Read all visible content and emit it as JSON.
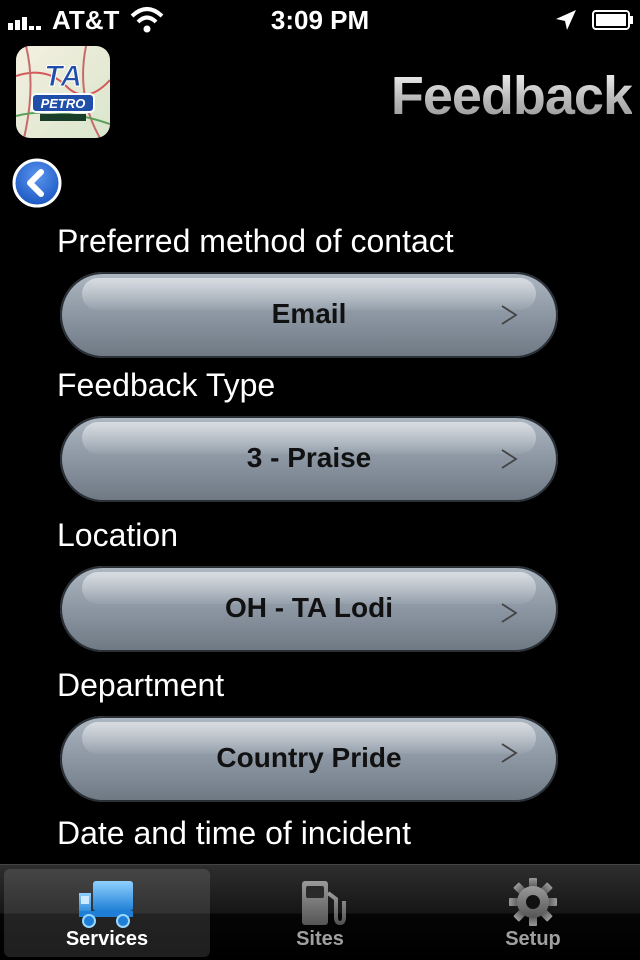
{
  "status_bar": {
    "carrier": "AT&T",
    "time": "3:09 PM"
  },
  "header": {
    "title": "Feedback",
    "logo_text": "PETRO",
    "logo_mark": "TA"
  },
  "form": {
    "fields": [
      {
        "label": "Preferred method of contact",
        "value": "Email"
      },
      {
        "label": "Feedback Type",
        "value": "3 - Praise"
      },
      {
        "label": "Location",
        "value": "OH - TA Lodi"
      },
      {
        "label": "Department",
        "value": "Country Pride"
      },
      {
        "label": "Date and time of incident"
      }
    ],
    "chevron": ">"
  },
  "tab_bar": {
    "tabs": [
      {
        "label": "Services",
        "icon": "truck-icon",
        "active": true
      },
      {
        "label": "Sites",
        "icon": "fuel-pump-icon",
        "active": false
      },
      {
        "label": "Setup",
        "icon": "gear-icon",
        "active": false
      }
    ]
  },
  "colors": {
    "background": "#000000",
    "pill": "#8f9aa6",
    "back_button": "#2f6fd6",
    "logo_red": "#d42a2a",
    "logo_blue": "#1f4fa8"
  }
}
